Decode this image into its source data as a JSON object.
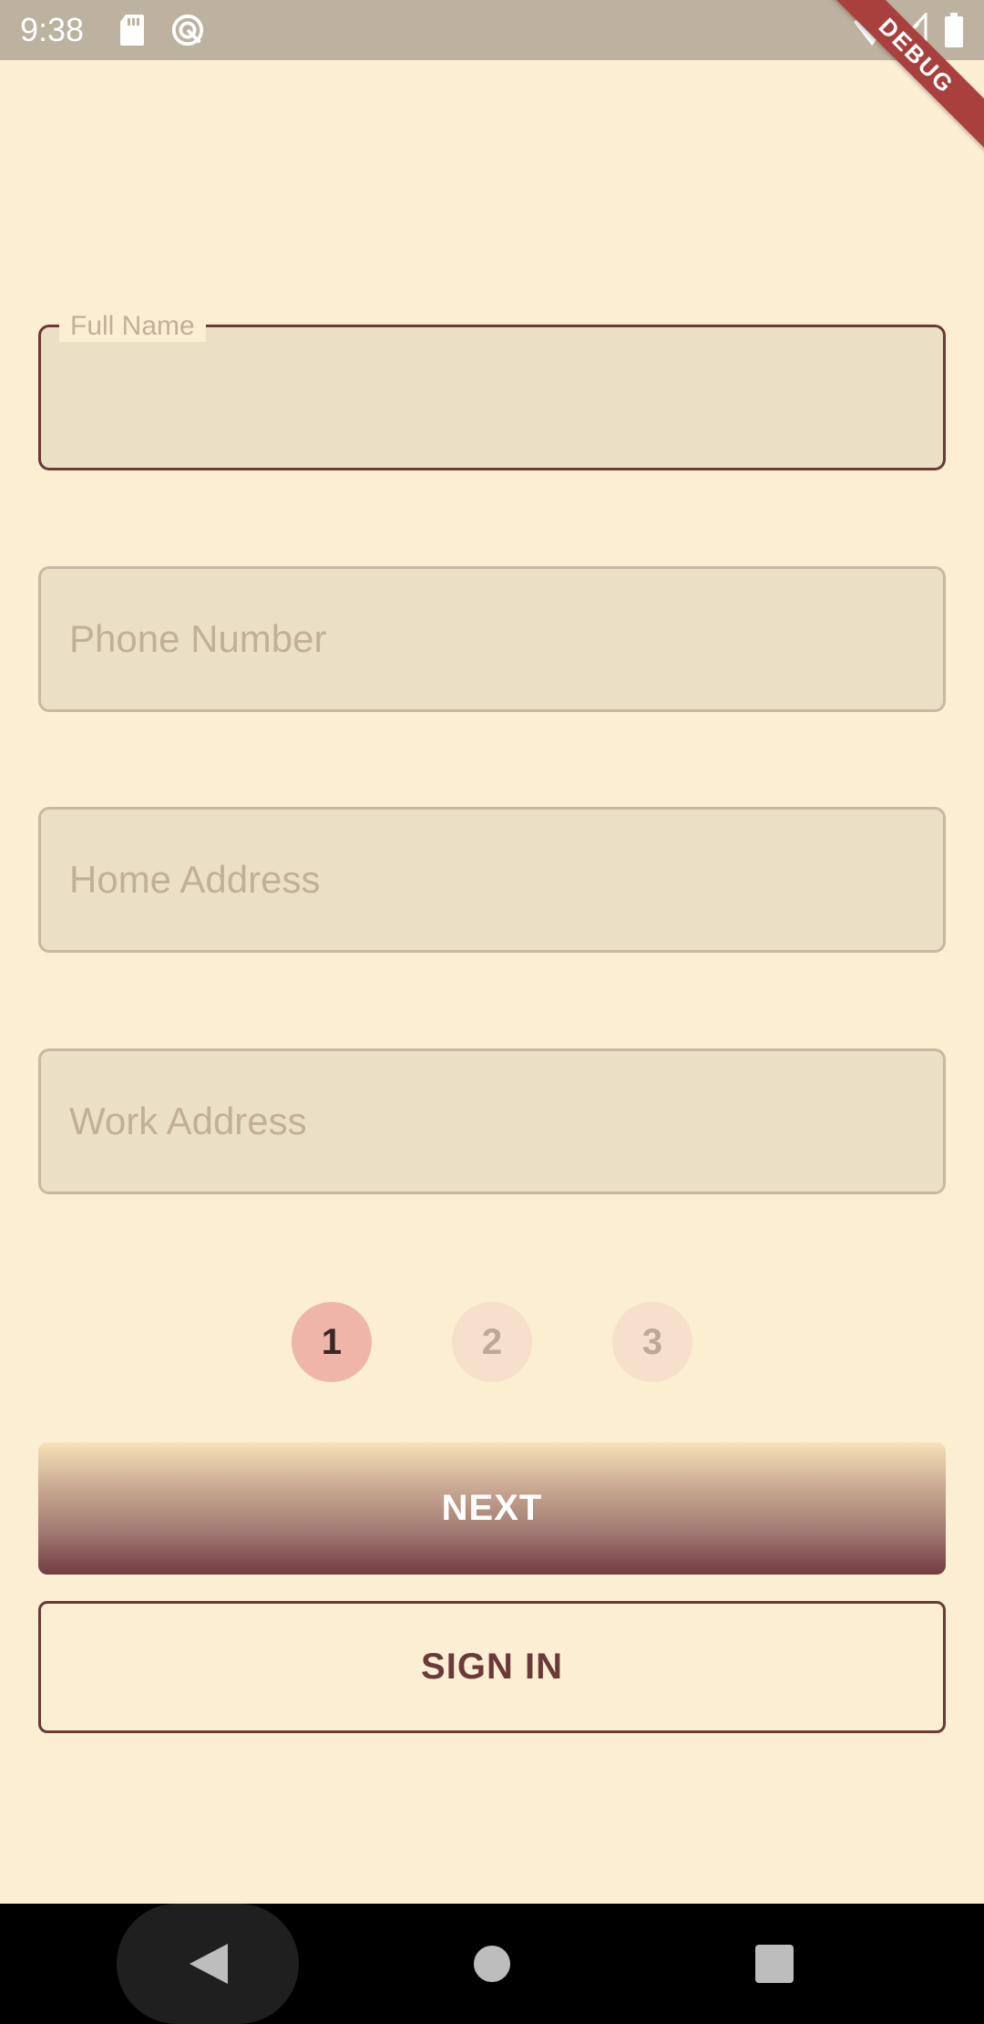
{
  "status_bar": {
    "time": "9:38",
    "icons": [
      "sd-card-icon",
      "sync-icon",
      "wifi-icon",
      "signal-icon",
      "battery-icon"
    ]
  },
  "debug_banner": "DEBUG",
  "form": {
    "full_name": {
      "label": "Full Name",
      "value": ""
    },
    "phone_number": {
      "placeholder": "Phone Number",
      "value": ""
    },
    "home_address": {
      "placeholder": "Home Address",
      "value": ""
    },
    "work_address": {
      "placeholder": "Work Address",
      "value": ""
    }
  },
  "steps": [
    {
      "label": "1",
      "active": true
    },
    {
      "label": "2",
      "active": false
    },
    {
      "label": "3",
      "active": false
    }
  ],
  "buttons": {
    "next": "NEXT",
    "sign_in": "SIGN IN"
  },
  "nav_bar": {
    "icons": [
      "back-icon",
      "home-icon",
      "recents-icon"
    ]
  },
  "colors": {
    "background": "#FBEED3",
    "status_bar": "#BDB29F",
    "field_fill": "#EBDFC5",
    "field_border": "#C9B7A3",
    "focused_border": "#6B3A38",
    "placeholder": "#C2AF9A",
    "step_active": "#EEB5A8",
    "step_inactive": "#F6DFCB",
    "primary": "#6B3A38",
    "debug_ribbon": "#A8403D"
  }
}
